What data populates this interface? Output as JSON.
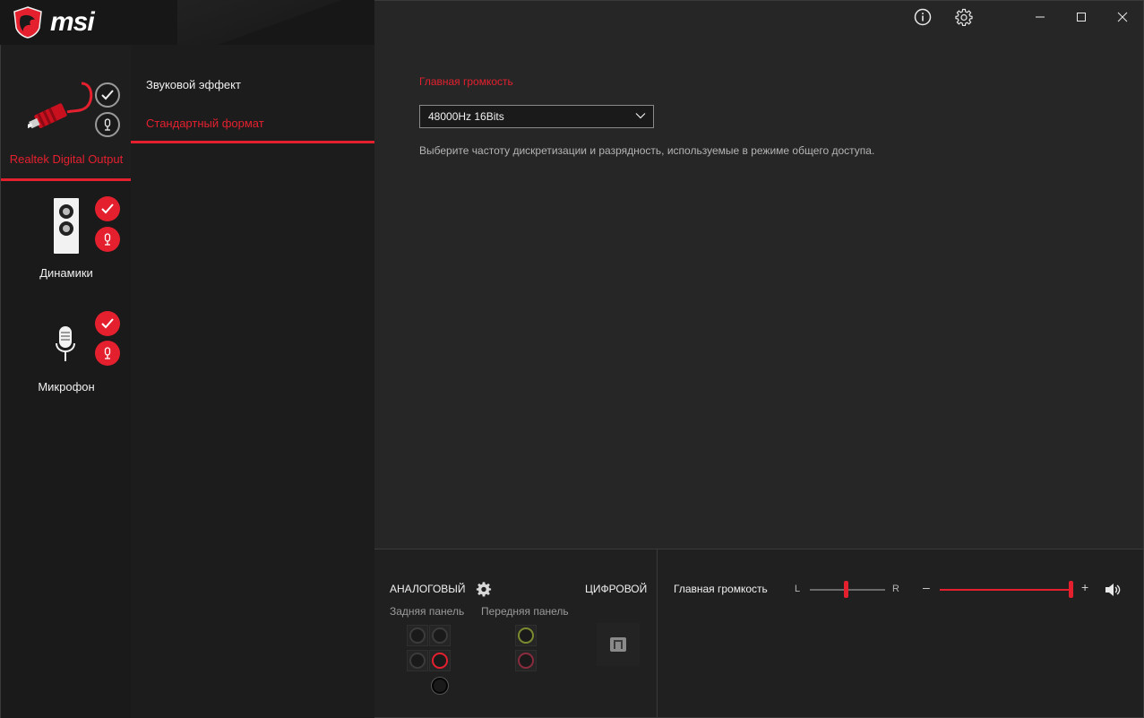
{
  "app": {
    "logo_text": "msi"
  },
  "devices": [
    {
      "label": "Realtek Digital Output",
      "icon": "digital-cable-icon",
      "selected": true
    },
    {
      "label": "Динамики",
      "icon": "speaker-icon",
      "selected": false
    },
    {
      "label": "Микрофон",
      "icon": "microphone-icon",
      "selected": false
    }
  ],
  "submenu": {
    "items": [
      {
        "label": "Звуковой эффект",
        "active": false
      },
      {
        "label": "Стандартный формат",
        "active": true
      }
    ]
  },
  "main": {
    "section_title": "Главная громкость",
    "format_select": {
      "value": "48000Hz 16Bits"
    },
    "description": "Выберите частоту дискретизации и разрядность, используемые в режиме общего доступа."
  },
  "window": {
    "icons": [
      "info-icon",
      "gear-icon",
      "minimize-icon",
      "maximize-icon",
      "close-icon"
    ]
  },
  "bottom": {
    "analog_label": "АНАЛОГОВЫЙ",
    "digital_label": "ЦИФРОВОЙ",
    "rear_panel_label": "Задняя панель",
    "front_panel_label": "Передняя панель",
    "volume_label": "Главная громкость",
    "balance_left": "L",
    "balance_right": "R",
    "balance_value": 0.5,
    "volume_value": 1.0,
    "volume_minus": "–",
    "volume_plus": "+"
  },
  "colors": {
    "accent": "#e4202f",
    "background": "#242424",
    "sidebar": "#1a1a1a"
  }
}
